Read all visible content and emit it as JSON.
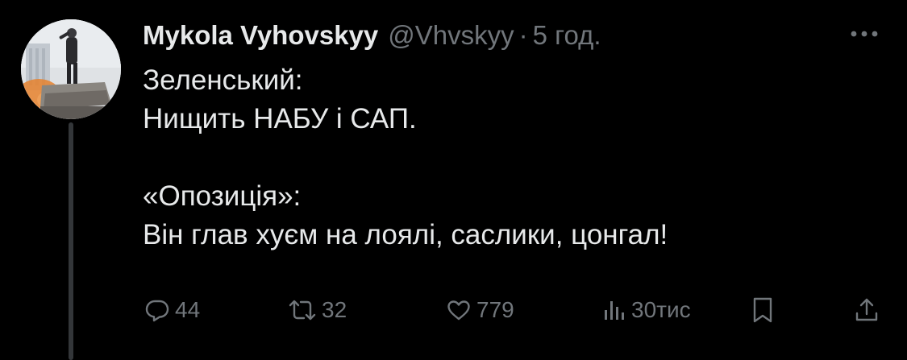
{
  "author": {
    "display_name": "Mykola Vyhovskyy",
    "handle": "@Vhvskyy",
    "separator": "·",
    "time": "5 год."
  },
  "body": {
    "lines": [
      "Зеленський:",
      "Нищить НАБУ і САП.",
      "",
      "«Опозиція»:",
      "Він глав хуєм на лоялі, саслики, цонгал!"
    ]
  },
  "actions": {
    "replies": "44",
    "reposts": "32",
    "likes": "779",
    "views": "30тис"
  },
  "icons": {
    "more": "more-horizontal-icon",
    "reply": "reply-icon",
    "repost": "repost-icon",
    "like": "heart-icon",
    "views": "views-icon",
    "bookmark": "bookmark-icon",
    "share": "share-icon"
  },
  "colors": {
    "background": "#000000",
    "text_primary": "#e7e9ea",
    "text_secondary": "#71767b",
    "thread_line": "#333639"
  }
}
